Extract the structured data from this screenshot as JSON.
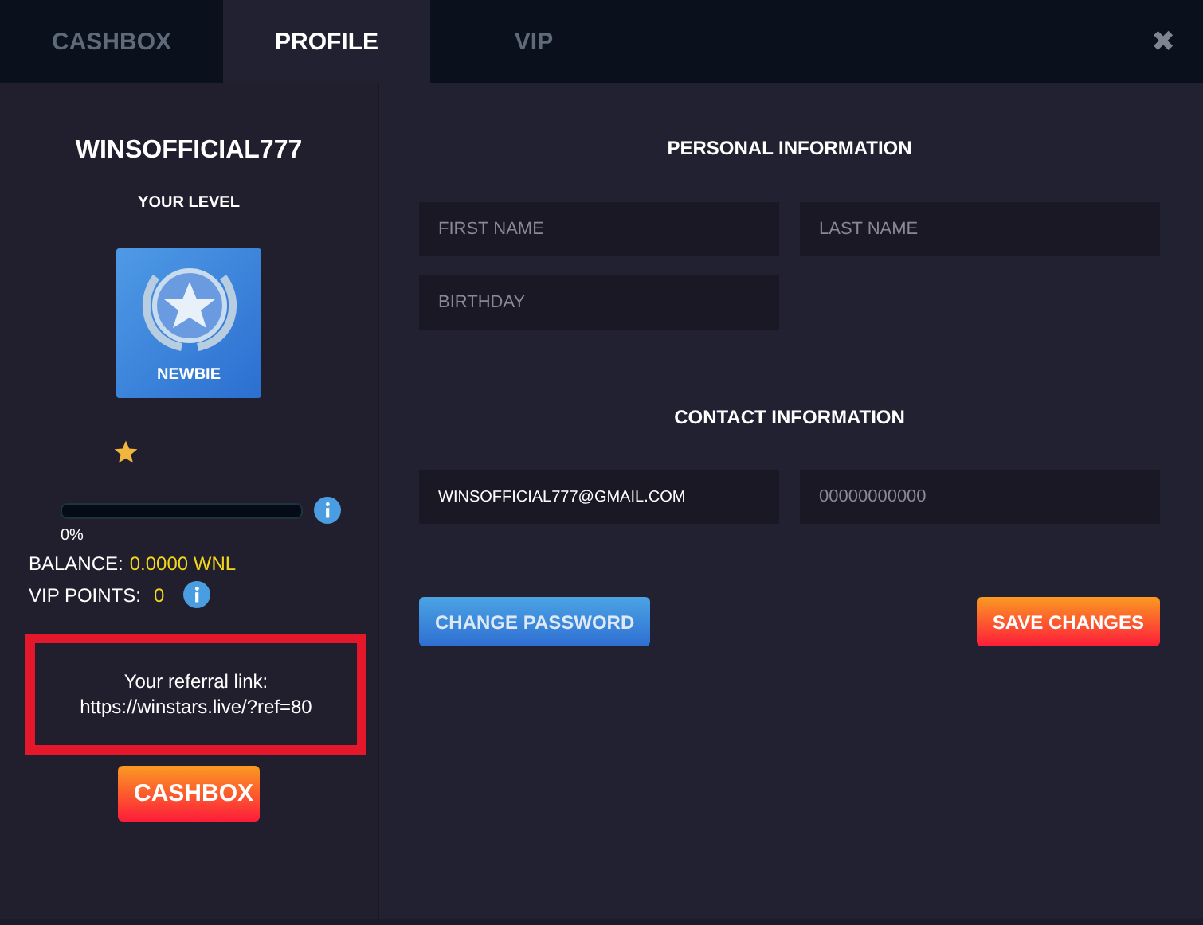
{
  "tabs": [
    {
      "label": "CASHBOX",
      "selected": false
    },
    {
      "label": "PROFILE",
      "selected": true
    },
    {
      "label": "VIP",
      "selected": false
    }
  ],
  "close": "✖",
  "profile": {
    "username": "WINSOFFICIAL777",
    "level_heading": "YOUR LEVEL",
    "level_name": "NEWBIE",
    "progress": {
      "level": 0,
      "reading": "0%"
    },
    "balance": {
      "label": "BALANCE:",
      "value": "0.0000 WNL"
    },
    "vip_points": {
      "label": "VIP POINTS:",
      "value": "0"
    },
    "referral": {
      "label": "Your referral link:",
      "link": "https://winstars.live/?ref=80",
      "highlighted": true
    },
    "cashbox_button": "CASHBOX"
  },
  "personal": {
    "title": "PERSONAL INFORMATION",
    "fields": [
      {
        "placeholder": "FIRST NAME"
      },
      {
        "placeholder": "LAST NAME"
      },
      {
        "placeholder": "BIRTHDAY"
      }
    ]
  },
  "contact": {
    "title": "CONTACT INFORMATION",
    "fields": [
      {
        "value": "WINSOFFICIAL777@GMAIL.COM"
      },
      {
        "placeholder": "00000000000"
      }
    ]
  },
  "buttons": [
    {
      "label": "CHANGE PASSWORD",
      "kind": "secondary"
    },
    {
      "label": "SAVE CHANGES",
      "kind": "primary"
    }
  ]
}
